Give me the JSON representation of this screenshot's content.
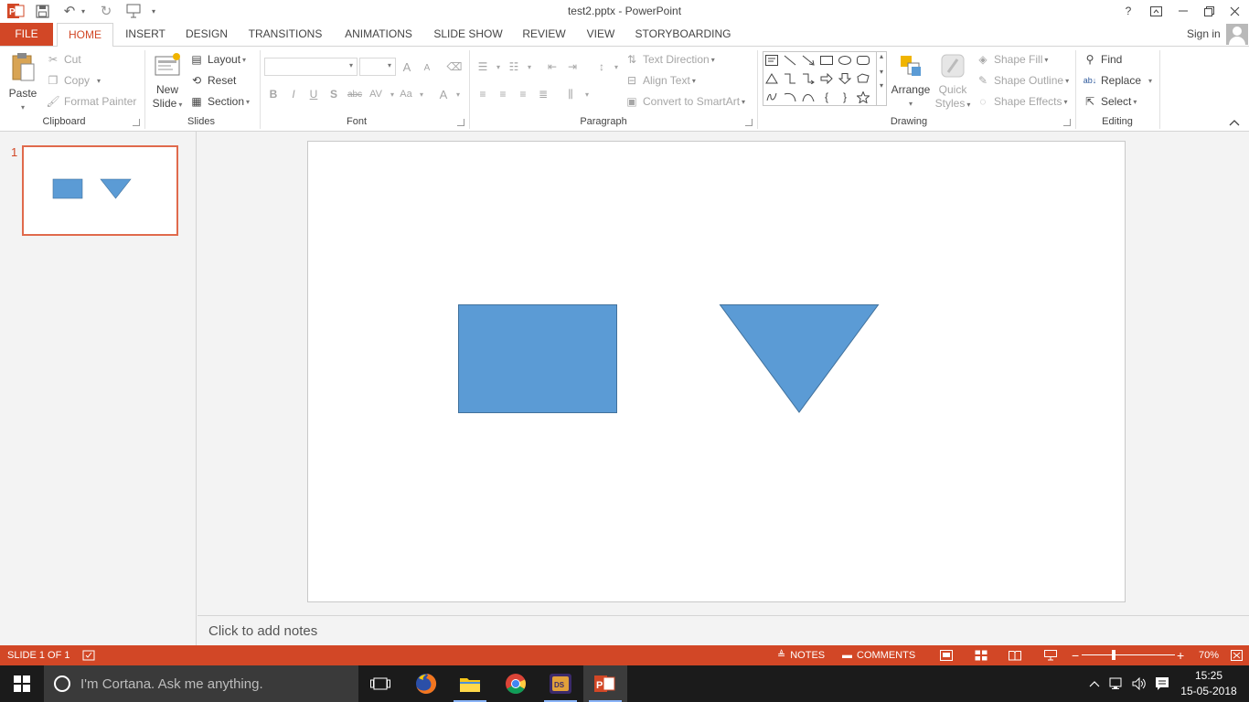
{
  "titlebar": {
    "title": "test2.pptx - PowerPoint",
    "help": "?",
    "window_buttons": [
      "?",
      "restore-ribbon",
      "minimize",
      "maximize",
      "close"
    ]
  },
  "tabs": {
    "file": "FILE",
    "items": [
      "HOME",
      "INSERT",
      "DESIGN",
      "TRANSITIONS",
      "ANIMATIONS",
      "SLIDE SHOW",
      "REVIEW",
      "VIEW",
      "STORYBOARDING"
    ],
    "sign_in": "Sign in"
  },
  "ribbon": {
    "clipboard": {
      "paste": "Paste",
      "cut": "Cut",
      "copy": "Copy",
      "format_painter": "Format Painter",
      "label": "Clipboard"
    },
    "slides": {
      "new_slide_line1": "New",
      "new_slide_line2": "Slide",
      "layout": "Layout",
      "reset": "Reset",
      "section": "Section",
      "label": "Slides"
    },
    "font": {
      "font_name": "",
      "font_size": "",
      "grow": "A",
      "shrink": "A",
      "bold": "B",
      "italic": "I",
      "underline": "U",
      "shadow": "S",
      "strike": "abc",
      "spacing": "AV",
      "case": "Aa",
      "color": "A",
      "label": "Font"
    },
    "paragraph": {
      "text_direction": "Text Direction",
      "align_text": "Align Text",
      "convert_smartart": "Convert to SmartArt",
      "label": "Paragraph"
    },
    "drawing": {
      "arrange": "Arrange",
      "quick_styles_line1": "Quick",
      "quick_styles_line2": "Styles",
      "shape_fill": "Shape Fill",
      "shape_outline": "Shape Outline",
      "shape_effects": "Shape Effects",
      "label": "Drawing"
    },
    "editing": {
      "find": "Find",
      "replace": "Replace",
      "select": "Select",
      "label": "Editing"
    }
  },
  "thumbnails": [
    {
      "number": "1"
    }
  ],
  "slide": {
    "shapes": [
      "rectangle",
      "inverted-triangle"
    ],
    "fill_color": "#5b9bd5",
    "outline_color": "#41719c"
  },
  "notes": {
    "placeholder": "Click to add notes"
  },
  "statusbar": {
    "slide_info": "SLIDE 1 OF 1",
    "notes": "NOTES",
    "comments": "COMMENTS",
    "zoom": "70%",
    "zoom_level": 0.7
  },
  "taskbar": {
    "cortana_text": "I'm Cortana. Ask me anything.",
    "time": "15:25",
    "date": "15-05-2018"
  },
  "colors": {
    "accent": "#d24726",
    "taskbar": "#1b1b1b"
  }
}
